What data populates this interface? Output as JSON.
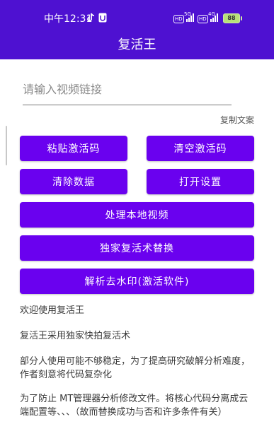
{
  "status_bar": {
    "time": "中午12:31",
    "left_icons": [
      "tiktok-icon",
      "notification-icon"
    ],
    "sim1": {
      "hd": "HD",
      "network": "5G"
    },
    "sim2": {
      "hd": "HD",
      "network": "4G"
    },
    "battery": "88"
  },
  "app_bar": {
    "title": "复活王"
  },
  "input": {
    "placeholder": "请输入视频链接",
    "value": ""
  },
  "copy_text_label": "复制文案",
  "buttons": {
    "paste_code": "粘贴激活码",
    "clear_code": "清空激活码",
    "clear_data": "清除数据",
    "open_settings": "打开设置",
    "process_local_video": "处理本地视频",
    "exclusive_revive": "独家复活术替换",
    "remove_watermark": "解析去水印(激活软件)"
  },
  "info": {
    "p1": "欢迎使用复活王",
    "p2": "复活王采用独家快拍复活术",
    "p3": "部分人使用可能不够稳定，为了提高研究破解分析难度，作者刻意将代码复杂化",
    "p4": "为了防止 MT管理器分析修改文件。将核心代码分离成云端配置等、、、（故而替换成功与否和许多条件有关）"
  },
  "colors": {
    "app_bar": "#4e11d1",
    "button": "#6a01ef"
  }
}
